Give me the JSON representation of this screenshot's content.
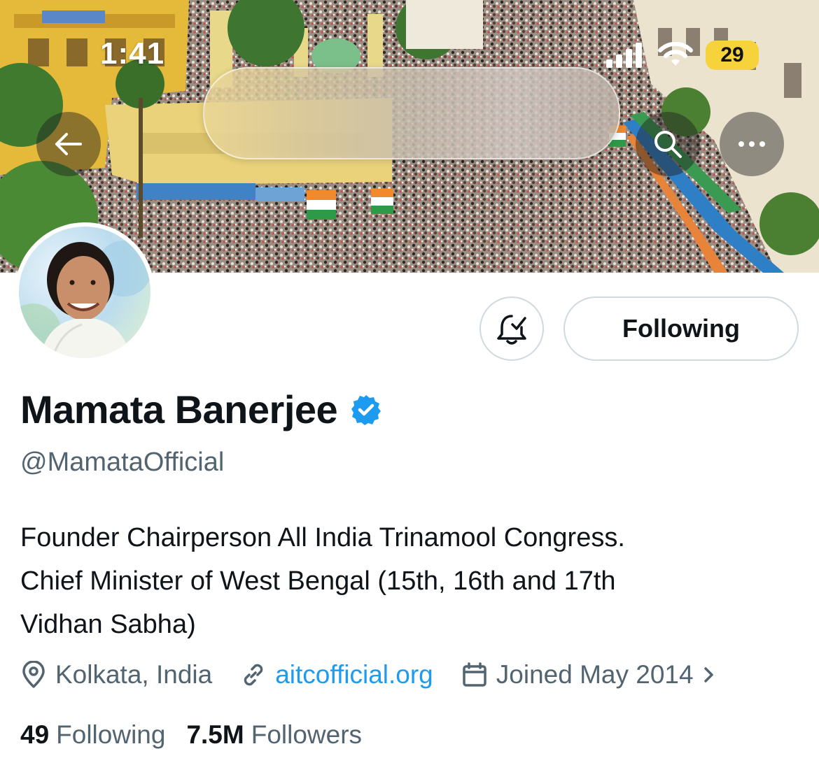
{
  "status_bar": {
    "time": "1:41",
    "battery": "29"
  },
  "header": {
    "back_icon": "arrow-left-icon",
    "search_icon": "search-icon",
    "more_icon": "ellipsis-icon"
  },
  "actions": {
    "notifications_icon": "bell-check-icon",
    "following_label": "Following"
  },
  "profile": {
    "name": "Mamata Banerjee",
    "verified_icon": "verified-badge-icon",
    "handle": "@MamataOfficial",
    "bio_lines": [
      "Founder Chairperson All India Trinamool Congress.",
      "Chief Minister of West Bengal (15th, 16th and 17th",
      "Vidhan Sabha)"
    ],
    "location": "Kolkata, India",
    "website": "aitcofficial.org",
    "joined": "Joined May 2014",
    "following_count": "49",
    "following_label": "Following",
    "followers_count": "7.5M",
    "followers_label": "Followers"
  },
  "colors": {
    "accent": "#1d9bf0",
    "secondary_text": "#536471",
    "primary_text": "#0f1419",
    "border": "#cfd9de",
    "battery": "#f6d33b"
  }
}
